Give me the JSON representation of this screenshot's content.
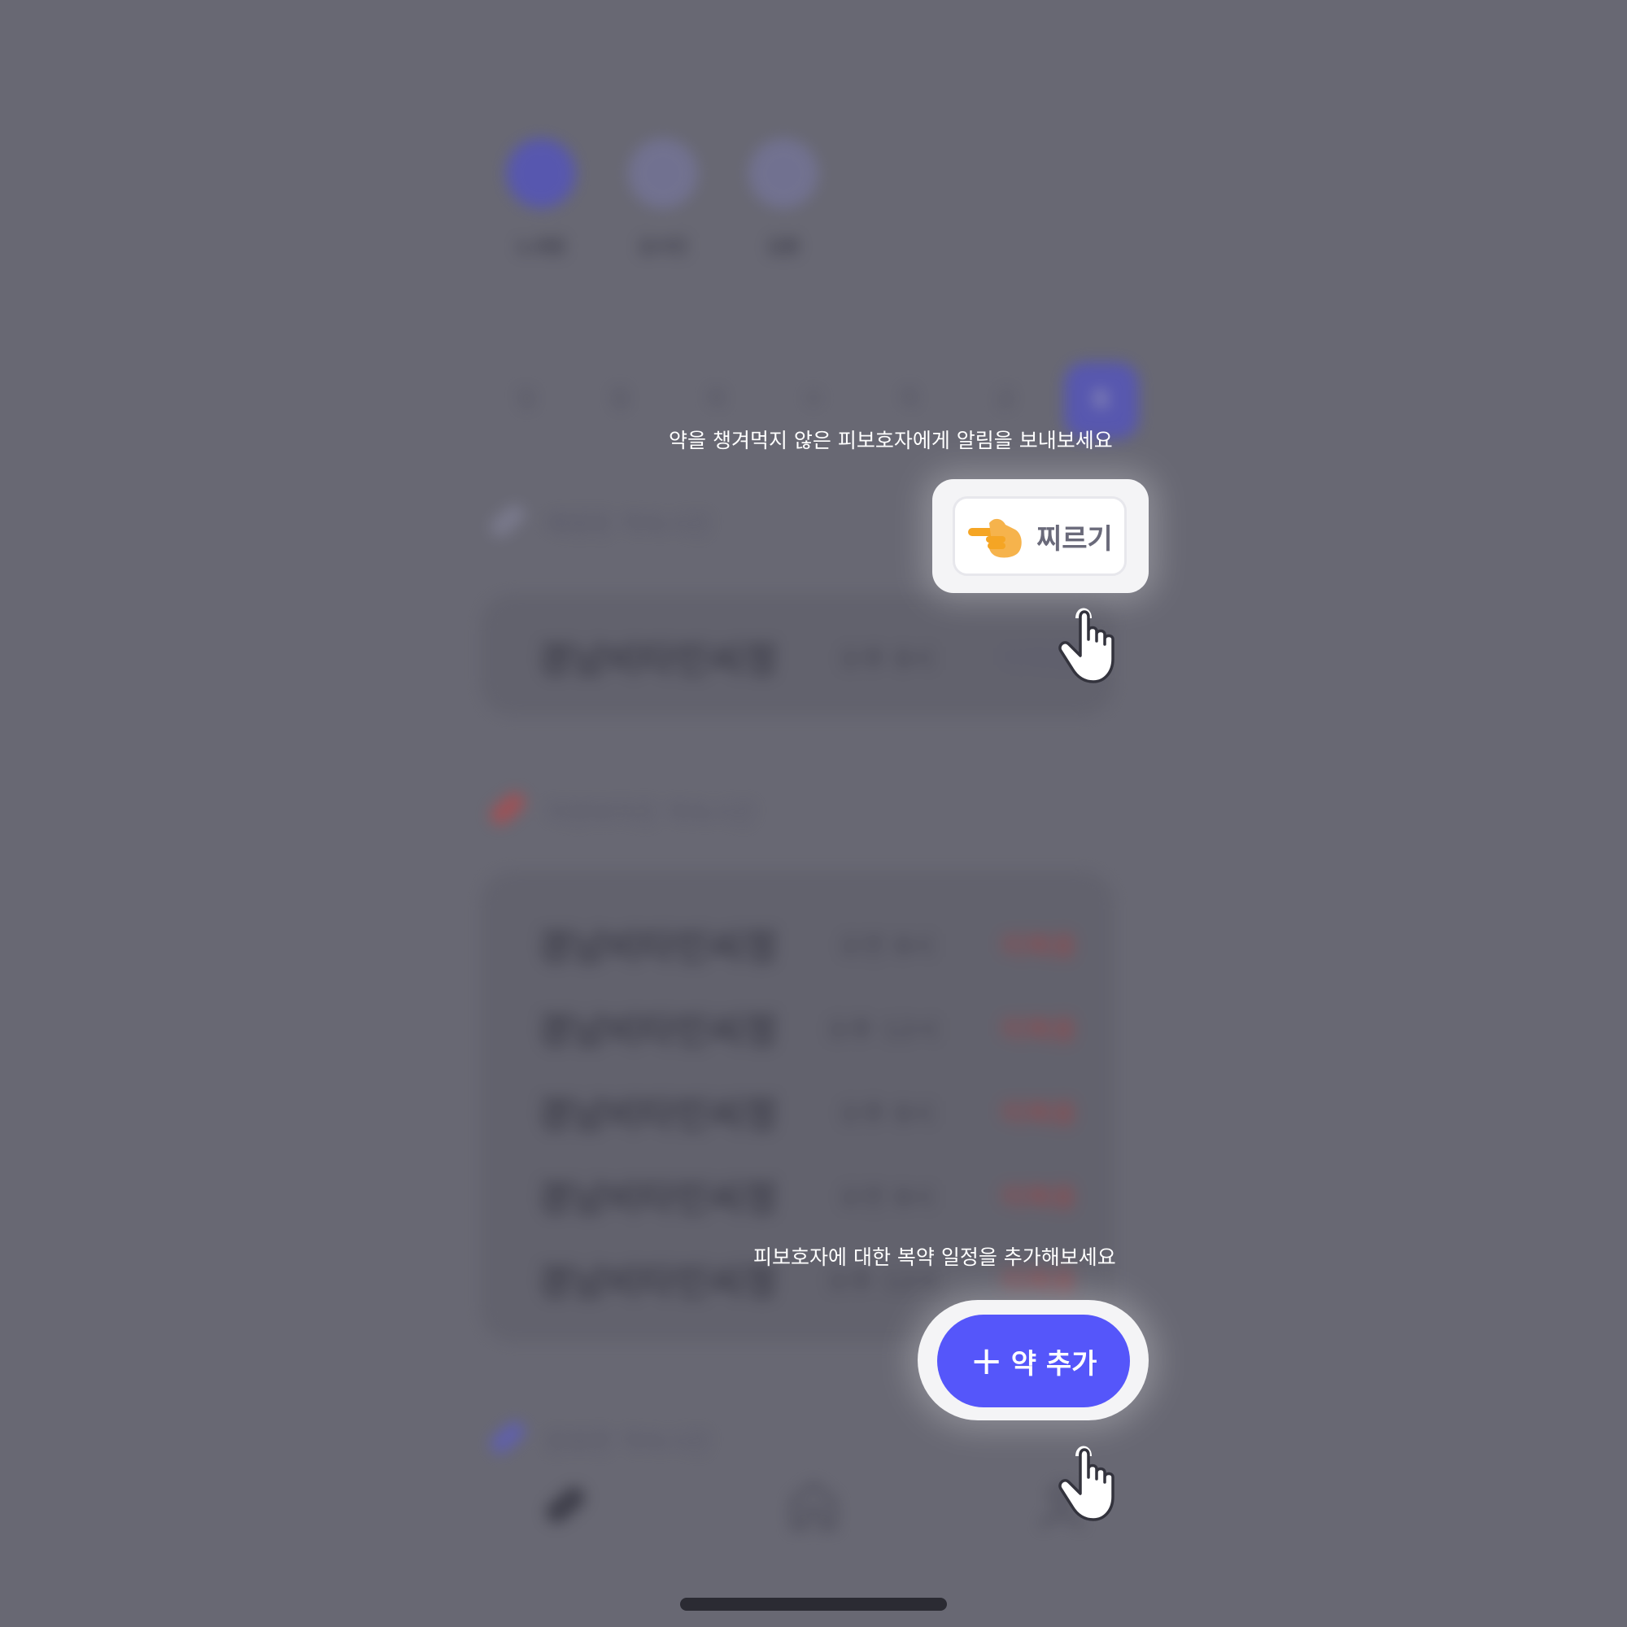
{
  "background": {
    "profiles": [
      {
        "name": "노새원",
        "color": "#4a4ae0"
      },
      {
        "name": "김서진",
        "color": "#7a7aa8"
      },
      {
        "name": "김훈",
        "color": "#7a7aa8"
      }
    ],
    "week_days": [
      "일",
      "월",
      "화",
      "수",
      "목",
      "금",
      "토"
    ],
    "sections": {
      "scheduled": {
        "title": "예정된 약속시간",
        "icon": "pill-icon",
        "color": "#8888a0"
      },
      "missed": {
        "title": "지연되어진 약속시간",
        "icon": "pill-icon",
        "color": "#c84040"
      },
      "done": {
        "title": "완료한 약속시간",
        "icon": "pill-icon",
        "color": "#5a5ad8"
      }
    },
    "scheduled_rows": [
      {
        "med": "경남비타민씨정",
        "time": "오후 8시",
        "status": "미복용"
      }
    ],
    "missed_rows": [
      {
        "med": "경남비타민씨정",
        "time": "오전 8시",
        "status": "미복용"
      },
      {
        "med": "경남비타민씨정",
        "time": "오후 12시",
        "status": "미복용"
      },
      {
        "med": "경남비타민씨정",
        "time": "오후 8시",
        "status": "미복용"
      },
      {
        "med": "경남비타민씨정",
        "time": "오전 8시",
        "status": "미복용"
      },
      {
        "med": "경남비타민씨정",
        "time": "오후 12시",
        "status": "미복용"
      }
    ],
    "nav": [
      {
        "icon": "pill-icon"
      },
      {
        "icon": "home-icon"
      },
      {
        "icon": "user-icon"
      }
    ]
  },
  "coach": {
    "poke_hint": "약을 챙겨먹지 않은 피보호자에게 알림을 보내보세요",
    "poke_label": "찌르기",
    "add_hint": "피보호자에 대한 복약 일정을 추가해보세요",
    "add_plus": "+",
    "add_label": "약 추가",
    "accent": "#5556fa"
  }
}
